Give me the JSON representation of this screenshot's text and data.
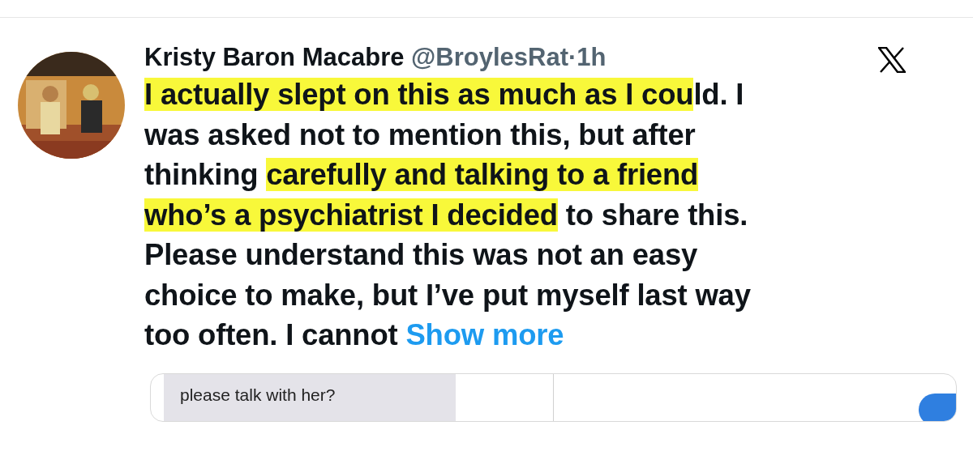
{
  "tweet": {
    "author": "Kristy Baron Macabre",
    "handle": "@BroylesRat",
    "separator": "·",
    "time": "1h",
    "body_lines": [
      [
        {
          "kind": "text",
          "text": "I actually slept on this as much as I cou",
          "highlighted": true
        },
        {
          "kind": "text",
          "text": "ld. I",
          "highlighted": false
        }
      ],
      [
        {
          "kind": "text",
          "text": "was asked not to mention this, but after",
          "highlighted": false
        }
      ],
      [
        {
          "kind": "text",
          "text": "thinking ",
          "highlighted": false
        },
        {
          "kind": "text",
          "text": "carefully and talking to a friend",
          "highlighted": true
        }
      ],
      [
        {
          "kind": "text",
          "text": "who’s a psychiatrist I decided",
          "highlighted": true
        },
        {
          "kind": "text",
          "text": " to share this.",
          "highlighted": false
        }
      ],
      [
        {
          "kind": "text",
          "text": "Please understand this was not an easy",
          "highlighted": false
        }
      ],
      [
        {
          "kind": "text",
          "text": "choice to make, but I’ve put myself last way",
          "highlighted": false
        }
      ],
      [
        {
          "kind": "text",
          "text": "too often. I cannot ",
          "highlighted": false
        },
        {
          "kind": "link",
          "text": "Show more",
          "highlighted": false
        }
      ]
    ],
    "media": {
      "caption": "please talk with her?"
    }
  }
}
